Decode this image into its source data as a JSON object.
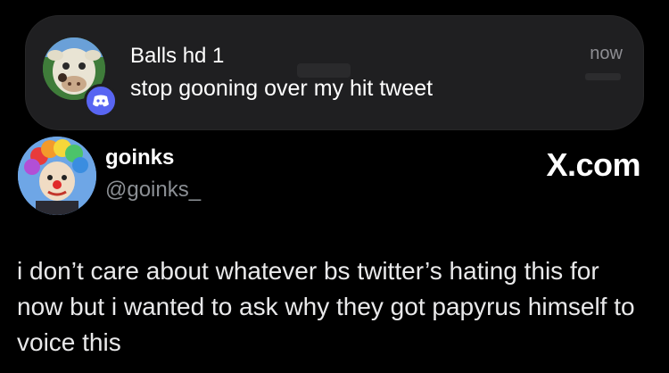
{
  "notification": {
    "sender": "Balls hd 1",
    "message": "stop gooning over my hit tweet",
    "time": "now",
    "app_icon": "discord-icon",
    "avatar_icon": "cow-avatar-icon"
  },
  "tweet": {
    "display_name": "goinks",
    "handle": "@goinks_",
    "source": "X.com",
    "avatar_icon": "clown-avatar-icon",
    "text": "i don’t care about whatever bs twitter’s hating this for now but i wanted to ask why they got papyrus himself to voice this"
  },
  "colors": {
    "background": "#000000",
    "notification_bg": "#1f1f21",
    "discord": "#5865f2",
    "secondary_text": "#8b8f94"
  }
}
